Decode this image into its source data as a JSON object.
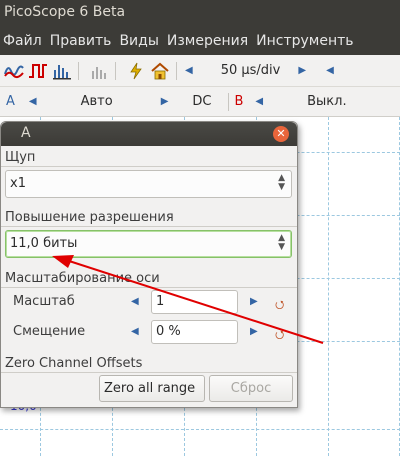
{
  "window": {
    "title": "PicoScope 6 Beta"
  },
  "menu": [
    "Файл",
    "Править",
    "Виды",
    "Измерения",
    "Инструменть"
  ],
  "toolbar1": {
    "timebase": "50 µs/div",
    "icons": [
      "scope-mode-icon",
      "pulse-icon",
      "spectrum-icon",
      "persistence-icon",
      "trigger-icon",
      "home-icon"
    ]
  },
  "toolbar2": {
    "channel_a_label": "A",
    "channel_a_range": "Авто",
    "channel_a_coupling": "DC",
    "channel_b_label": "B",
    "channel_b_state": "Выкл."
  },
  "scope": {
    "value_label": "10,0"
  },
  "dialog": {
    "title": "A",
    "probe": {
      "label": "Щуп",
      "value": "x1"
    },
    "resolution": {
      "label": "Повышение разрешения",
      "value": "11,0 биты"
    },
    "axis_scaling": {
      "label": "Масштабирование оси",
      "scale_label": "Масштаб",
      "scale_value": "1",
      "offset_label": "Смещение",
      "offset_value": "0 %"
    },
    "zero_offsets": {
      "label": "Zero Channel Offsets",
      "zero_all_button": "Zero all range",
      "reset_button": "Сброс"
    }
  },
  "colors": {
    "accent": "#3465a4",
    "annotation": "#e00000",
    "titlebar": "#3c3b37",
    "close": "#e9653b"
  }
}
